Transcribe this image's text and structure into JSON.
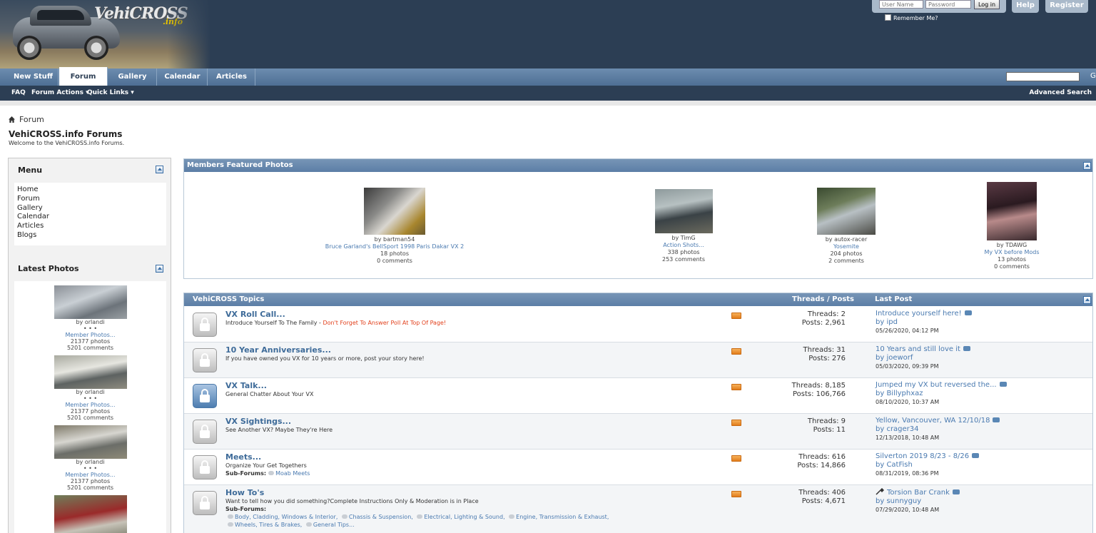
{
  "header": {
    "logo_text": "VehiCROSS",
    "logo_sub": ".info",
    "username_placeholder": "User Name",
    "password_placeholder": "Password",
    "login_label": "Log in",
    "remember_label": "Remember Me?",
    "help_label": "Help",
    "register_label": "Register"
  },
  "nav": {
    "tabs": [
      {
        "label": "New Stuff"
      },
      {
        "label": "Forum"
      },
      {
        "label": "Gallery"
      },
      {
        "label": "Calendar"
      },
      {
        "label": "Articles"
      }
    ],
    "search_go": "G",
    "subnav": {
      "faq": "FAQ",
      "forum_actions": "Forum Actions ▾",
      "quick_links": "Quick Links ▾",
      "advanced_search": "Advanced Search"
    }
  },
  "breadcrumb": {
    "label": "Forum"
  },
  "page": {
    "title": "VehiCROSS.info Forums",
    "description": "Welcome to the VehiCROSS.info Forums."
  },
  "sidebar": {
    "menu_title": "Menu",
    "menu_items": [
      "Home",
      "Forum",
      "Gallery",
      "Calendar",
      "Articles",
      "Blogs"
    ],
    "latest_title": "Latest Photos",
    "latest_photos": [
      {
        "by": "by orlandi",
        "dots": "• • •",
        "album": "Member Photos...",
        "photos": "21377 photos",
        "comments": "5201 comments"
      },
      {
        "by": "by orlandi",
        "dots": "• • •",
        "album": "Member Photos...",
        "photos": "21377 photos",
        "comments": "5201 comments"
      },
      {
        "by": "by orlandi",
        "dots": "• • •",
        "album": "Member Photos...",
        "photos": "21377 photos",
        "comments": "5201 comments"
      }
    ]
  },
  "featured": {
    "title": "Members Featured Photos",
    "items": [
      {
        "by": "by bartman54",
        "album": "Bruce Garland's BellSport 1998 Paris Dakar VX 2",
        "photos": "18 photos",
        "comments": "0 comments"
      },
      {
        "by": "by TimG",
        "album": "Action Shots...",
        "photos": "338 photos",
        "comments": "253 comments"
      },
      {
        "by": "by autox-racer",
        "album": "Yosemite",
        "photos": "204 photos",
        "comments": "2 comments"
      },
      {
        "by": "by TDAWG",
        "album": "My VX before Mods",
        "photos": "13 photos",
        "comments": "0 comments"
      }
    ]
  },
  "topics": {
    "title": "VehiCROSS Topics",
    "col_threads": "Threads / Posts",
    "col_last": "Last Post",
    "forums": [
      {
        "title": "VX Roll Call...",
        "desc": "Introduce Yourself To The Family - ",
        "desc_red": "Don't Forget To Answer Poll At Top Of Page!",
        "threads": "Threads: 2",
        "posts": "Posts: 2,961",
        "last_title": "Introduce yourself here!",
        "last_by": "by ipd",
        "last_date": "05/26/2020, 04:12 PM"
      },
      {
        "title": "10 Year Anniversaries...",
        "desc": "If you have owned you VX for 10 years or more, post your story here!",
        "threads": "Threads: 31",
        "posts": "Posts: 276",
        "last_title": "10 Years and still love it",
        "last_by": "by joeworf",
        "last_date": "05/03/2020, 09:39 PM"
      },
      {
        "title": "VX Talk...",
        "desc": "General Chatter About Your VX",
        "threads": "Threads: 8,185",
        "posts": "Posts: 106,766",
        "last_title": "Jumped my VX but reversed the...",
        "last_by": "by Billyphxaz",
        "last_date": "08/10/2020, 10:37 AM"
      },
      {
        "title": "VX Sightings...",
        "desc": "See Another VX? Maybe They're Here",
        "threads": "Threads: 9",
        "posts": "Posts: 11",
        "last_title": "Yellow, Vancouver, WA 12/10/18",
        "last_by": "by crager34",
        "last_date": "12/13/2018, 10:48 AM"
      },
      {
        "title": "Meets...",
        "desc": "Organize Your Get Togethers",
        "sub_label": "Sub-Forums:",
        "subforums": [
          "Moab Meets"
        ],
        "threads": "Threads: 616",
        "posts": "Posts: 14,866",
        "last_title": "Silverton 2019 8/23 - 8/26",
        "last_by": "by CatFish",
        "last_date": "08/31/2019, 08:36 PM"
      },
      {
        "title": "How To's",
        "desc": "Want to tell how you did something?Complete Instructions Only & Moderation is in Place",
        "sub_label": "Sub-Forums:",
        "subforums_line1": [
          "Body, Cladding, Windows & Interior,",
          "Chassis & Suspension,",
          "Electrical, Lighting & Sound,",
          "Engine, Transmission & Exhaust,"
        ],
        "subforums_line2": [
          "Wheels, Tires & Brakes,",
          "General Tips..."
        ],
        "threads": "Threads: 406",
        "posts": "Posts: 4,671",
        "last_title": "Torsion Bar Crank",
        "last_by": "by sunnyguy",
        "last_date": "07/29/2020, 10:48 AM"
      }
    ]
  }
}
